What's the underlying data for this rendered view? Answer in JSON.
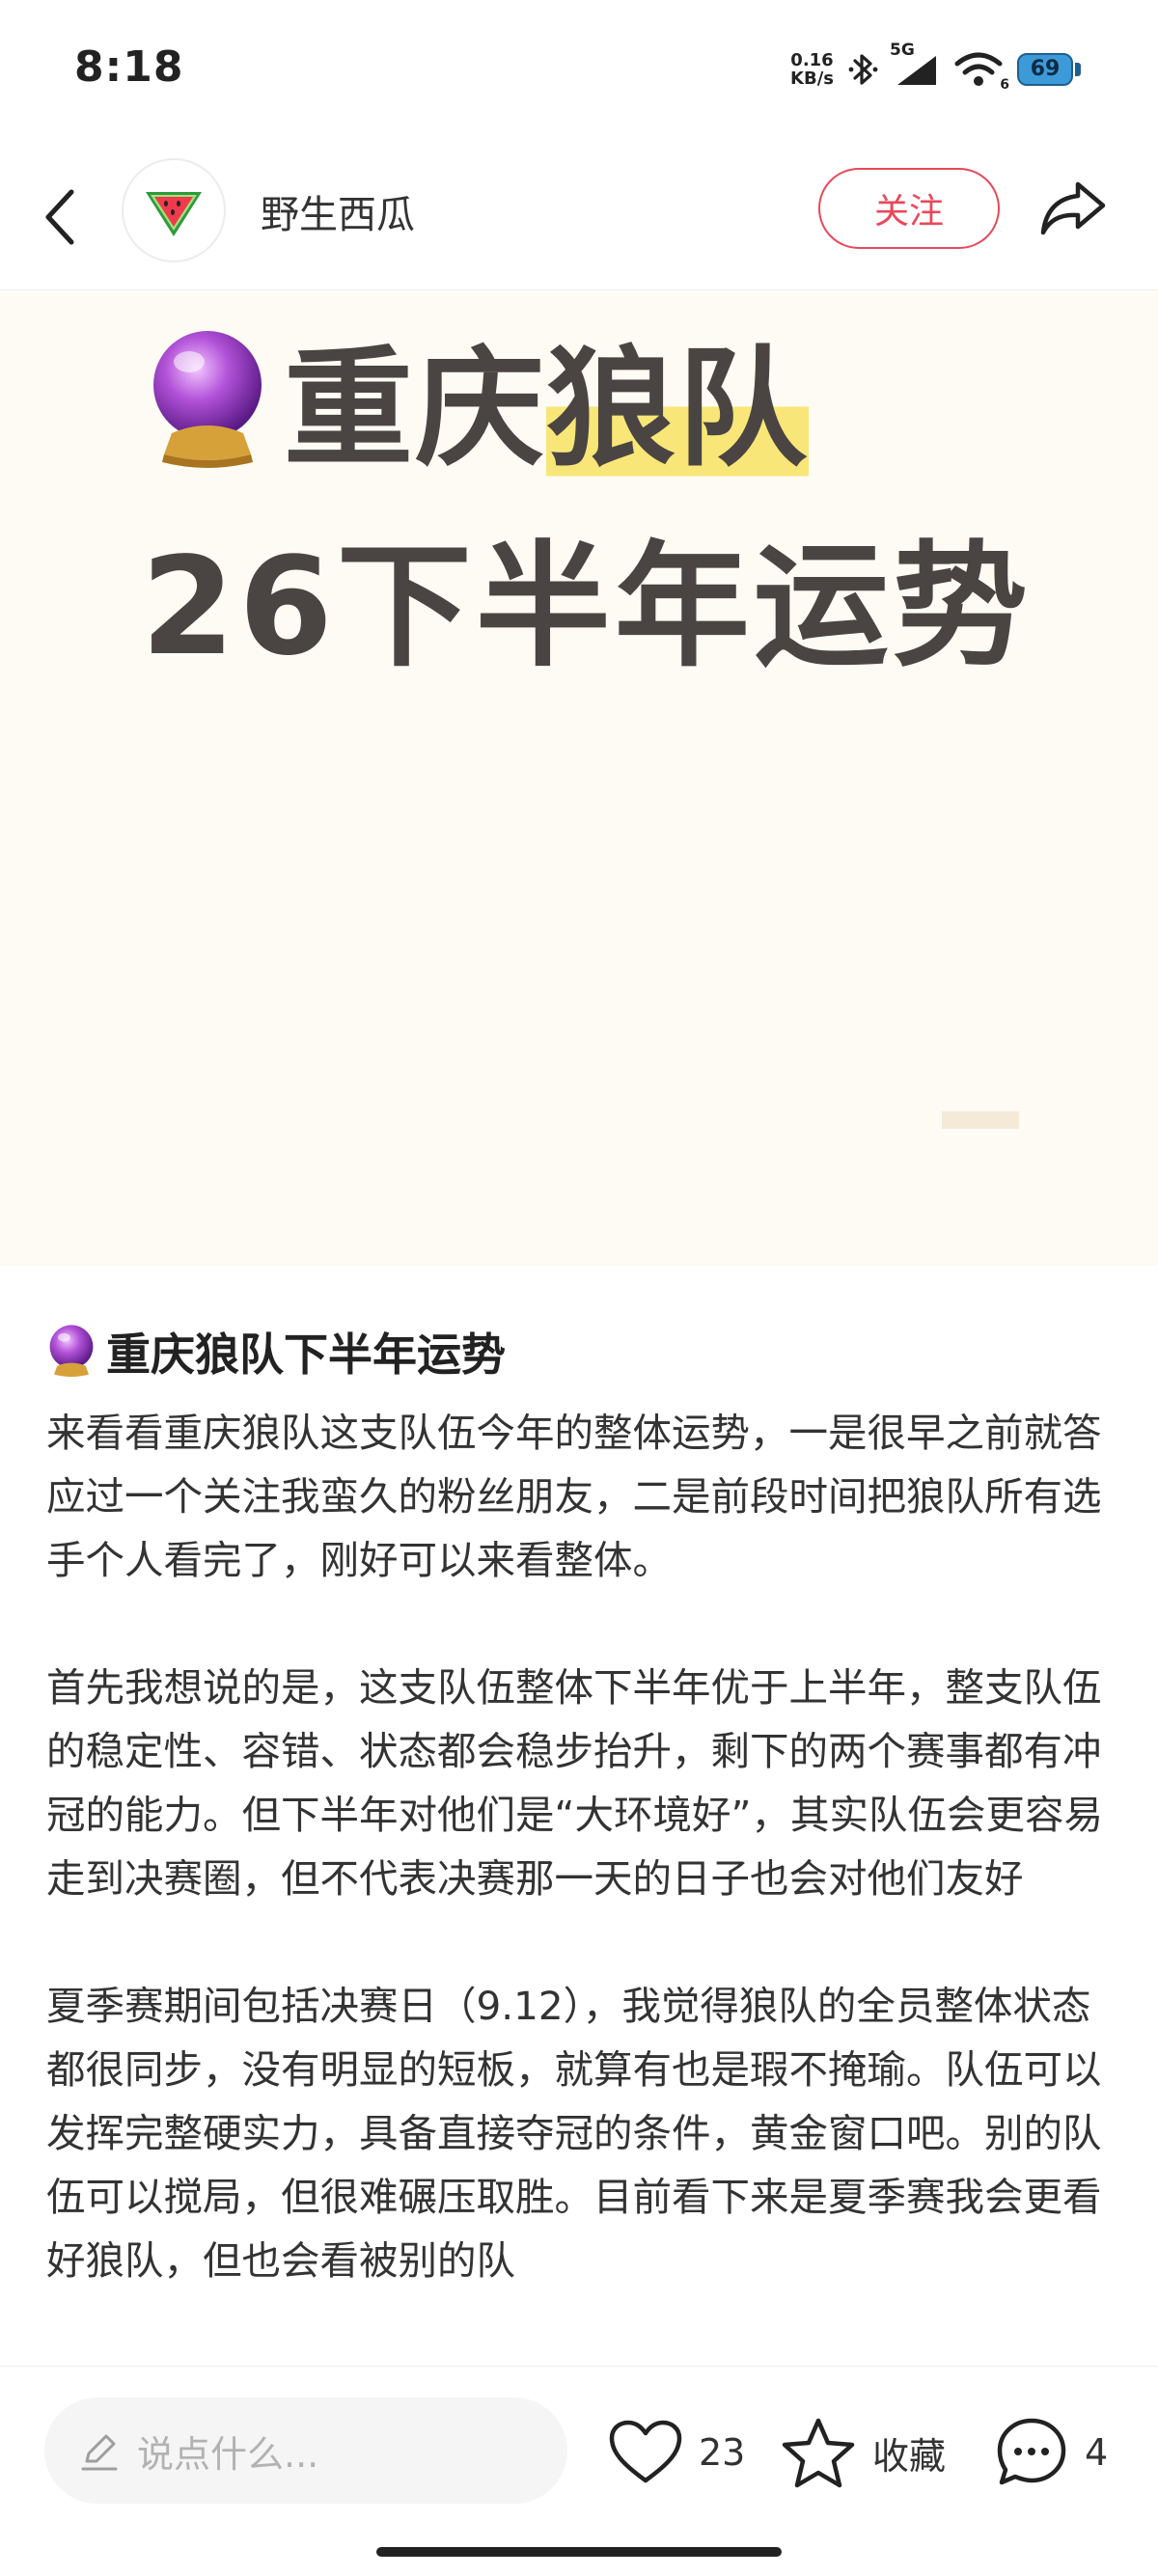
{
  "status_bar": {
    "time": "8:18",
    "net_speed_value": "0.16",
    "net_speed_unit": "KB/s",
    "network_type": "5G",
    "wifi_level": "6",
    "battery": "69",
    "icons": [
      "bluetooth-icon",
      "signal-icon",
      "wifi-icon",
      "battery-icon"
    ]
  },
  "header": {
    "back_icon": "chevron-left-icon",
    "avatar_icon": "watermelon-icon",
    "username": "野生西瓜",
    "follow_label": "关注",
    "share_icon": "share-arrow-icon",
    "accent_color": "#e8495a"
  },
  "cover": {
    "icon": "crystal-ball-icon",
    "title_part1": "重庆",
    "title_part2": "狼队",
    "subtitle": "26下半年运势",
    "highlight_color": "#f9e678"
  },
  "post": {
    "title_icon": "crystal-ball-icon",
    "title": "重庆狼队下半年运势",
    "paragraphs": [
      "来看看重庆狼队这支队伍今年的整体运势，一是很早之前就答应过一个关注我蛮久的粉丝朋友，二是前段时间把狼队所有选手个人看完了，刚好可以来看整体。",
      "首先我想说的是，这支队伍整体下半年优于上半年，整支队伍的稳定性、容错、状态都会稳步抬升，剩下的两个赛事都有冲冠的能力。但下半年对他们是“大环境好”，其实队伍会更容易走到决赛圈，但不代表决赛那一天的日子也会对他们友好",
      "夏季赛期间包括决赛日（9.12），我觉得狼队的全员整体状态都很同步，没有明显的短板，就算有也是瑕不掩瑜。队伍可以发挥完整硬实力，具备直接夺冠的条件，黄金窗口吧。别的队伍可以搅局，但很难碾压取胜。目前看下来是夏季赛我会更看好狼队，但也会看被别的队"
    ]
  },
  "bottom_bar": {
    "comment_placeholder": "说点什么...",
    "comment_icon": "pencil-icon",
    "like_icon": "heart-outline-icon",
    "like_count": "23",
    "favorite_icon": "star-outline-icon",
    "favorite_label": "收藏",
    "comments_icon": "chat-bubble-icon",
    "comment_count": "4"
  }
}
